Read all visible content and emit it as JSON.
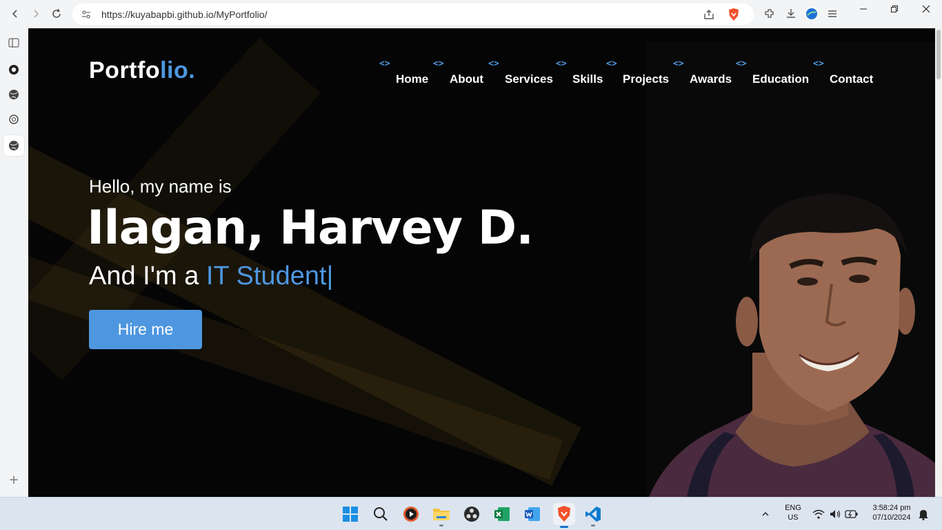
{
  "browser": {
    "url": "https://kuyabapbi.github.io/MyPortfolio/",
    "nav": {
      "back": "‹",
      "forward": "›",
      "reload": "↻"
    },
    "window": {
      "minimize": "—",
      "maximize": "❐",
      "close": "✕"
    }
  },
  "sidebar": {
    "items": [
      {
        "icon": "sidebar-panel-icon"
      },
      {
        "icon": "github-icon"
      },
      {
        "icon": "globe-icon"
      },
      {
        "icon": "openai-icon"
      },
      {
        "icon": "globe-icon"
      }
    ],
    "add": "+"
  },
  "site": {
    "logo_main": "Portfo",
    "logo_accent": "lio.",
    "menu_tag": "<>",
    "menu": [
      "Home",
      "About",
      "Services",
      "Skills",
      "Projects",
      "Awards",
      "Education",
      "Contact"
    ],
    "greeting": "Hello, my name is",
    "name": "Ilagan, Harvey D.",
    "role_prefix": "And I'm a ",
    "role_typed": "IT Student|",
    "cta": "Hire me",
    "accent_color": "#4e97e0"
  },
  "taskbar": {
    "apps": [
      "start",
      "search",
      "media-player",
      "file-explorer",
      "obs",
      "excel",
      "word",
      "brave",
      "vscode"
    ],
    "lang_top": "ENG",
    "lang_bottom": "US",
    "time": "3:58:24 pm",
    "date": "07/10/2024"
  }
}
